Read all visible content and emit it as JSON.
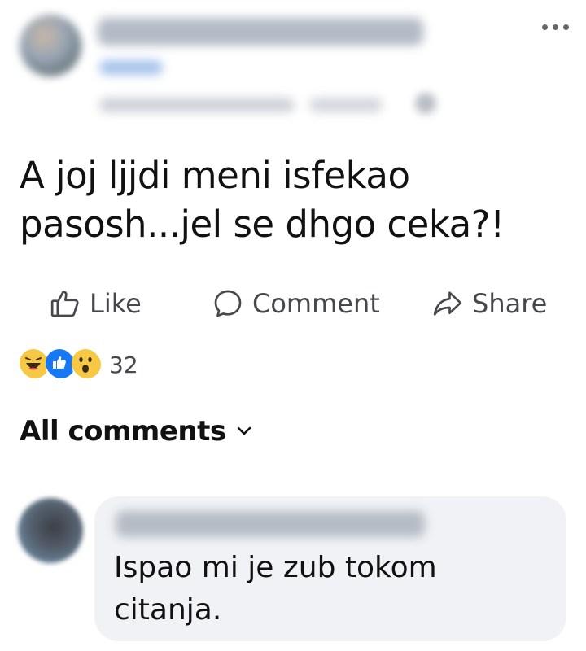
{
  "post": {
    "text_line1": "A joj ljjdi meni isfekao",
    "text_line2": "pasosh...jel se dhgo ceka?!"
  },
  "actions": {
    "like_label": "Like",
    "comment_label": "Comment",
    "share_label": "Share"
  },
  "reactions": {
    "types": [
      "haha",
      "like",
      "wow"
    ],
    "count": "32"
  },
  "comments_section": {
    "filter_label": "All comments"
  },
  "comments": [
    {
      "text_line1": "Ispao mi je zub tokom",
      "text_line2": "citanja."
    }
  ],
  "colors": {
    "like_blue": "#1877f2",
    "bubble_bg": "#f0f2f5",
    "secondary_text": "#65676b"
  }
}
